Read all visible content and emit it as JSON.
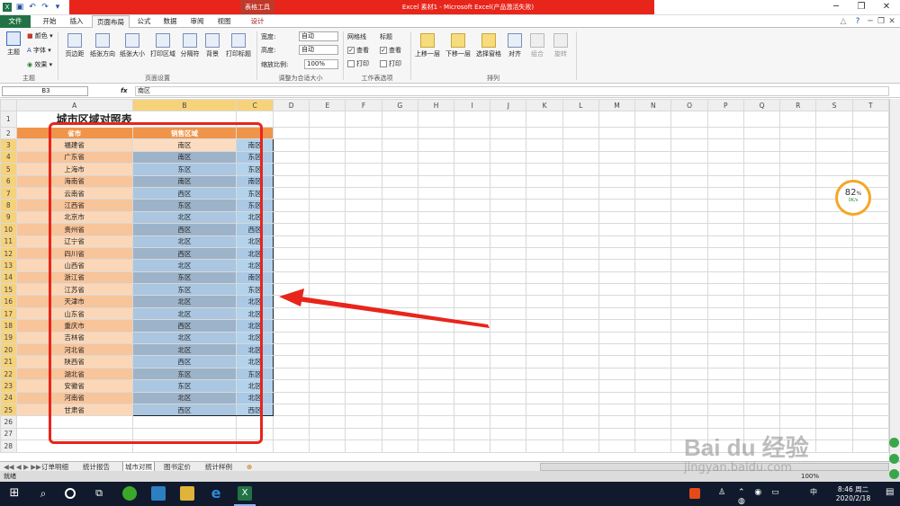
{
  "titlebar": {
    "tool_tab": "表格工具",
    "title": "Excel 素材1 - Microsoft Excel(产品激活失败)"
  },
  "tabs": [
    "开始",
    "插入",
    "页面布局",
    "公式",
    "数据",
    "审阅",
    "视图",
    "设计"
  ],
  "file_tab": "文件",
  "ribbon": {
    "theme": {
      "themes": "主题",
      "colors": "颜色",
      "fonts": "字体",
      "effects": "效果",
      "group": "主题"
    },
    "page_setup": {
      "margins": "页边距",
      "orientation": "纸张方向",
      "size": "纸张大小",
      "print_area": "打印区域",
      "breaks": "分隔符",
      "background": "背景",
      "print_titles": "打印标题",
      "group": "页面设置"
    },
    "scale": {
      "width_label": "宽度:",
      "width_value": "自动",
      "height_label": "高度:",
      "height_value": "自动",
      "scale_label": "缩放比例:",
      "scale_value": "100%",
      "group": "调整为合适大小"
    },
    "sheet_options": {
      "gridlines": "网格线",
      "headings": "标题",
      "view": "查看",
      "print": "打印",
      "group": "工作表选项"
    },
    "arrange": {
      "bring_forward": "上移一层",
      "send_backward": "下移一层",
      "selection_pane": "选择窗格",
      "align": "对齐",
      "group_btn": "组合",
      "rotate": "旋转",
      "group": "排列"
    }
  },
  "formula_bar": {
    "name_box": "B3",
    "fx": "fx",
    "content": "南区"
  },
  "columns": [
    "A",
    "B",
    "C",
    "D",
    "E",
    "F",
    "G",
    "H",
    "I",
    "J",
    "K",
    "L",
    "M",
    "N",
    "O",
    "P",
    "Q",
    "R",
    "S",
    "T"
  ],
  "sheet": {
    "title": "城市区域对照表",
    "header_city": "省市",
    "header_region": "销售区域",
    "rows": [
      [
        "福建省",
        "南区",
        "南区"
      ],
      [
        "广东省",
        "南区",
        "东区"
      ],
      [
        "上海市",
        "东区",
        "东区"
      ],
      [
        "海南省",
        "南区",
        "南区"
      ],
      [
        "云南省",
        "西区",
        "东区"
      ],
      [
        "江西省",
        "东区",
        "东区"
      ],
      [
        "北京市",
        "北区",
        "北区"
      ],
      [
        "贵州省",
        "西区",
        "西区"
      ],
      [
        "辽宁省",
        "北区",
        "北区"
      ],
      [
        "四川省",
        "西区",
        "北区"
      ],
      [
        "山西省",
        "北区",
        "北区"
      ],
      [
        "浙江省",
        "东区",
        "南区"
      ],
      [
        "江苏省",
        "东区",
        "东区"
      ],
      [
        "天津市",
        "北区",
        "北区"
      ],
      [
        "山东省",
        "北区",
        "北区"
      ],
      [
        "重庆市",
        "西区",
        "北区"
      ],
      [
        "吉林省",
        "北区",
        "北区"
      ],
      [
        "河北省",
        "北区",
        "北区"
      ],
      [
        "陕西省",
        "西区",
        "北区"
      ],
      [
        "湖北省",
        "东区",
        "东区"
      ],
      [
        "安徽省",
        "东区",
        "北区"
      ],
      [
        "河南省",
        "北区",
        "北区"
      ],
      [
        "甘肃省",
        "西区",
        "西区"
      ]
    ],
    "row_numbers": [
      1,
      2,
      3,
      4,
      5,
      6,
      7,
      8,
      9,
      10,
      11,
      12,
      13,
      14,
      15,
      16,
      17,
      18,
      19,
      20,
      21,
      22,
      23,
      24,
      25,
      26,
      27,
      28
    ]
  },
  "sheet_tabs": [
    "订单明细",
    "统计报告",
    "城市对照",
    "图书定价",
    "统计样例"
  ],
  "status": {
    "ready": "就绪",
    "zoom": "100%"
  },
  "speed_widget": {
    "percent": "82",
    "unit": "%",
    "rate": "0K/s"
  },
  "taskbar": {
    "time": "8:46 周二",
    "date": "2020/2/18",
    "lang": "中"
  },
  "watermark": {
    "text": "Bai du 经验",
    "url": "jingyan.baidu.com"
  },
  "colors": {
    "excel_green": "#217346",
    "title_red": "#e8251b",
    "header_orange": "#f0944a",
    "selection_blue": "#a9c6e2",
    "annotation_red": "#e8251b"
  }
}
